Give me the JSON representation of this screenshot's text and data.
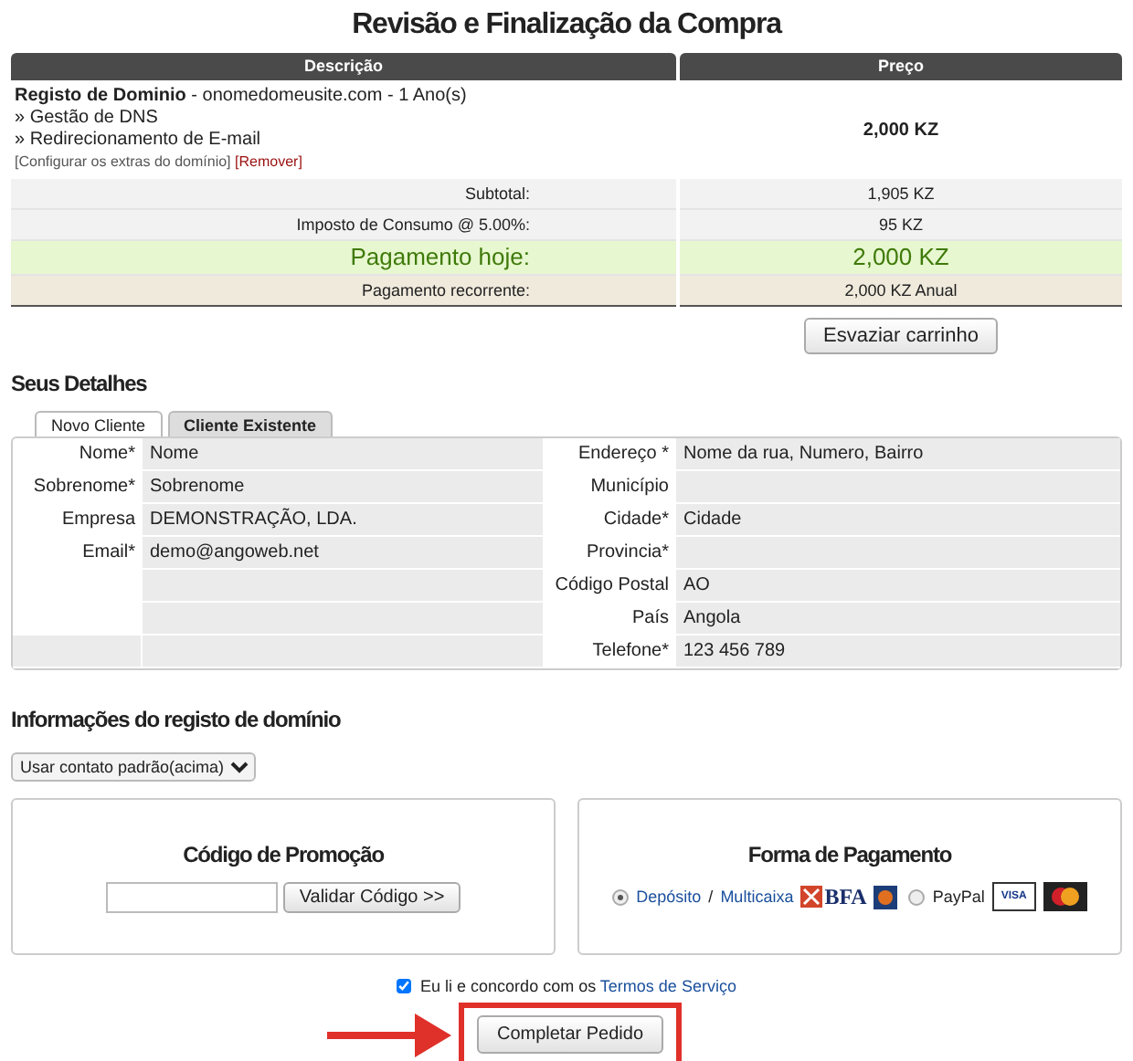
{
  "title": "Revisão e Finalização da Compra",
  "cart": {
    "columns": [
      "Descrição",
      "Preço"
    ],
    "items": [
      {
        "name": "Registo de Dominio",
        "detail": " - onomedomeusite.com - 1 Ano(s)",
        "addons": [
          "» Gestão de DNS",
          "» Redirecionamento de E-mail"
        ],
        "links": [
          {
            "label": "[Configurar os extras do domínio]",
            "kind": "normal"
          },
          {
            "label": "[Remover]",
            "kind": "danger"
          }
        ],
        "price": "2,000 KZ"
      }
    ],
    "totals": [
      {
        "label": "Subtotal:",
        "value": "1,905 KZ",
        "kind": "plain"
      },
      {
        "label": "Imposto de Consumo @ 5.00%:",
        "value": "95 KZ",
        "kind": "plain"
      },
      {
        "label": "Pagamento hoje:",
        "value": "2,000 KZ",
        "kind": "today"
      },
      {
        "label": "Pagamento recorrente:",
        "value": "2,000 KZ Anual",
        "kind": "recurring"
      }
    ],
    "empty_button": "Esvaziar carrinho"
  },
  "details": {
    "heading": "Seus Detalhes",
    "tabs": [
      {
        "label": "Novo Cliente",
        "selected": true
      },
      {
        "label": "Cliente Existente",
        "selected": false
      }
    ],
    "left_fields": [
      {
        "label": "Nome*",
        "value": "Nome"
      },
      {
        "label": "Sobrenome*",
        "value": "Sobrenome"
      },
      {
        "label": "Empresa",
        "value": "DEMONSTRAÇÃO, LDA."
      },
      {
        "label": "Email*",
        "value": "demo@angoweb.net"
      }
    ],
    "right_fields": [
      {
        "label": "Endereço *",
        "value": "Nome da rua, Numero, Bairro"
      },
      {
        "label": "Município"
      },
      {
        "label": "Cidade*",
        "value": "Cidade"
      },
      {
        "label": "Provincia*"
      },
      {
        "label": "Código Postal",
        "value": "AO"
      },
      {
        "label": "País",
        "value": "Angola"
      },
      {
        "label": "Telefone*",
        "value": "123 456 789"
      }
    ]
  },
  "domain_info": {
    "heading": "Informações do registo de domínio",
    "select": "Usar contato padrão(acima)"
  },
  "promo": {
    "heading": "Código de Promoção",
    "button": "Validar Código >>"
  },
  "payment": {
    "heading": "Forma de Pagamento",
    "methods": [
      {
        "kind": "bank",
        "selected": true,
        "links": [
          "Depósito",
          "Multicaixa"
        ],
        "separator": "/",
        "logo": "BFA"
      },
      {
        "kind": "paypal",
        "selected": false,
        "label": "PayPal",
        "card": "VISA"
      }
    ]
  },
  "terms": {
    "checked": true,
    "text": "Eu li e concordo com os",
    "link": "Termos de Serviço"
  },
  "submit": "Completar Pedido"
}
